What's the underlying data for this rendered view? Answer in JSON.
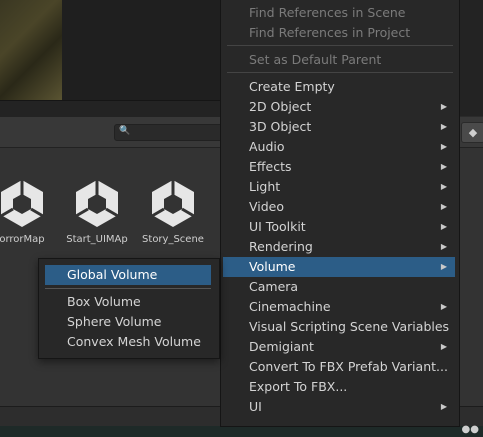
{
  "project": {
    "assets": [
      {
        "label": "orrorMap",
        "icon": "unity-scene-icon"
      },
      {
        "label": "Start_UIMAp",
        "icon": "unity-scene-icon"
      },
      {
        "label": "Story_Scene",
        "icon": "unity-scene-icon"
      }
    ]
  },
  "context_menu": {
    "items": [
      {
        "label": "Find References in Scene",
        "disabled": true
      },
      {
        "label": "Find References in Project",
        "disabled": true
      },
      {
        "label": "Set as Default Parent",
        "disabled": true
      },
      {
        "label": "Create Empty"
      },
      {
        "label": "2D Object",
        "submenu": true
      },
      {
        "label": "3D Object",
        "submenu": true
      },
      {
        "label": "Audio",
        "submenu": true
      },
      {
        "label": "Effects",
        "submenu": true
      },
      {
        "label": "Light",
        "submenu": true
      },
      {
        "label": "Video",
        "submenu": true
      },
      {
        "label": "UI Toolkit",
        "submenu": true
      },
      {
        "label": "Rendering",
        "submenu": true
      },
      {
        "label": "Volume",
        "submenu": true,
        "highlighted": true
      },
      {
        "label": "Camera"
      },
      {
        "label": "Cinemachine",
        "submenu": true
      },
      {
        "label": "Visual Scripting Scene Variables"
      },
      {
        "label": "Demigiant",
        "submenu": true
      },
      {
        "label": "Convert To FBX Prefab Variant..."
      },
      {
        "label": "Export To FBX..."
      },
      {
        "label": "UI",
        "submenu": true
      }
    ]
  },
  "volume_submenu": {
    "items": [
      {
        "label": "Global Volume",
        "highlighted": true
      },
      {
        "label": "Box Volume"
      },
      {
        "label": "Sphere Volume"
      },
      {
        "label": "Convex Mesh Volume"
      }
    ]
  },
  "colors": {
    "highlight": "#2c5d87",
    "menu_bg": "#282828",
    "text": "#d4d4d4",
    "disabled_text": "#7b7b7b"
  },
  "icons": {
    "search": "search-icon",
    "tag": "tag-icon",
    "submenu_arrow": "chevron-right-icon"
  }
}
